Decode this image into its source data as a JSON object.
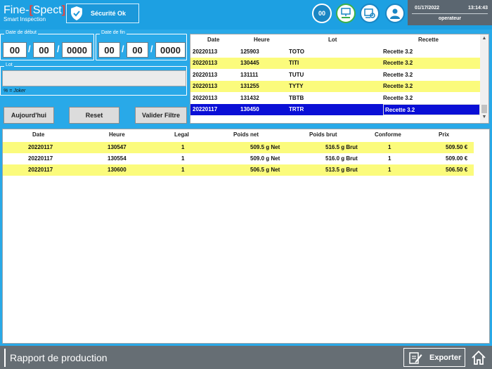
{
  "header": {
    "logo_prefix": "Fine-",
    "logo_bracket_open": "[",
    "logo_word": "Spect",
    "logo_bracket_close": "]",
    "logo_sub": "Smart Inspection",
    "security_label": "Sécurité Ok",
    "counter": "00",
    "date": "01/17/2022",
    "time": "13:14:43",
    "user": "operateur"
  },
  "filter": {
    "start_legend": "Date de début",
    "end_legend": "Date de fin",
    "start": {
      "day": "00",
      "month": "00",
      "year": "0000"
    },
    "end": {
      "day": "00",
      "month": "00",
      "year": "0000"
    },
    "slash": "/",
    "lot_legend": "Lot",
    "lot_value": "",
    "joker_hint": "% = Joker",
    "today_label": "Aujourd'hui",
    "reset_label": "Reset",
    "validate_label": "Valider Filtre"
  },
  "lot_table": {
    "headers": [
      "Date",
      "Heure",
      "Lot",
      "Recette"
    ],
    "rows": [
      {
        "date": "20220113",
        "heure": "125903",
        "lot": "TOTO",
        "recette": "Recette 3.2"
      },
      {
        "date": "20220113",
        "heure": "130445",
        "lot": "TITI",
        "recette": "Recette 3.2"
      },
      {
        "date": "20220113",
        "heure": "131111",
        "lot": "TUTU",
        "recette": "Recette 3.2"
      },
      {
        "date": "20220113",
        "heure": "131255",
        "lot": "TYTY",
        "recette": "Recette 3.2"
      },
      {
        "date": "20220113",
        "heure": "131432",
        "lot": "TBTB",
        "recette": "Recette 3.2"
      },
      {
        "date": "20220117",
        "heure": "130450",
        "lot": "TRTR",
        "recette": "Recette 3.2"
      }
    ]
  },
  "prod_table": {
    "headers": [
      "Date",
      "Heure",
      "Legal",
      "Poids net",
      "Poids brut",
      "Conforme",
      "Prix"
    ],
    "rows": [
      {
        "date": "20220117",
        "heure": "130547",
        "legal": "1",
        "net": "509.5 g Net",
        "brut": "516.5 g Brut",
        "conforme": "1",
        "prix": "509.50 €"
      },
      {
        "date": "20220117",
        "heure": "130554",
        "legal": "1",
        "net": "509.0 g Net",
        "brut": "516.0 g Brut",
        "conforme": "1",
        "prix": "509.00 €"
      },
      {
        "date": "20220117",
        "heure": "130600",
        "legal": "1",
        "net": "506.5 g Net",
        "brut": "513.5 g Brut",
        "conforme": "1",
        "prix": "506.50 €"
      }
    ]
  },
  "footer": {
    "title": "Rapport de production",
    "export_label": "Exporter"
  },
  "colors": {
    "background": "#29a9e8",
    "row_highlight": "#fbfb7c",
    "row_selected": "#0a0fd6",
    "footer": "#666e74"
  }
}
